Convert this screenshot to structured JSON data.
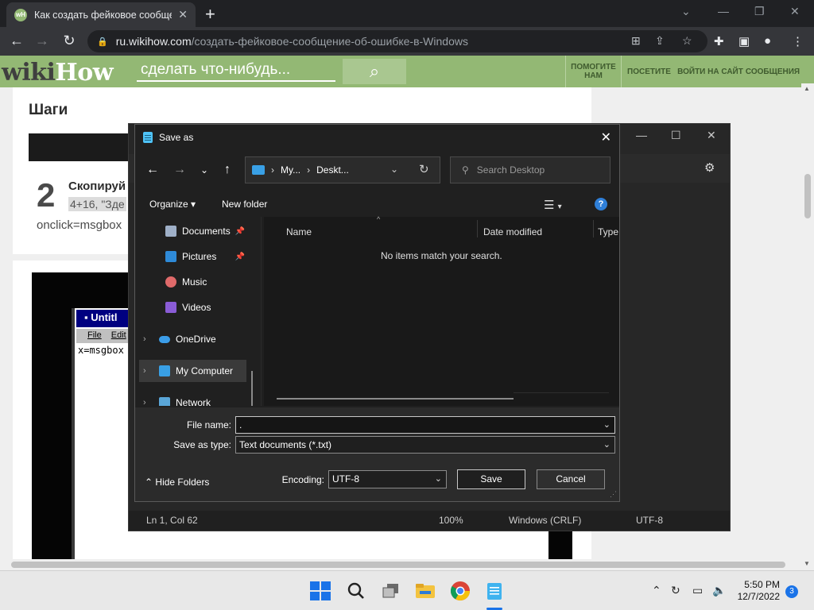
{
  "browser": {
    "tab_title": "Как создать фейковое сообщен",
    "favicon_text": "wH",
    "url_host": "ru.wikihow.com",
    "url_path": "/создать-фейковое-сообщение-об-ошибке-в-Windows"
  },
  "wikihow": {
    "logo_wiki": "wiki",
    "logo_how": "How",
    "search_placeholder": "сделать что-нибудь...",
    "nav": [
      "ПОМОГИТЕ НАМ",
      "ПОСЕТИТЕ",
      "ВОЙТИ НА САЙТ",
      "СООБЩЕНИЯ"
    ],
    "section_heading": "Шаги",
    "step_number": "2",
    "step_bold": "Скопируй",
    "step_code_line1": "4+16, \"Зде",
    "step_code_line2": "onclick=msgbox",
    "notepad_title": "Untitl",
    "notepad_menu": [
      "File",
      "Edit"
    ],
    "notepad_text": "x=msgbox"
  },
  "notepad": {
    "status": {
      "position": "Ln 1, Col 62",
      "zoom": "100%",
      "line_ending": "Windows (CRLF)",
      "encoding": "UTF-8"
    }
  },
  "dialog": {
    "title": "Save as",
    "breadcrumb": [
      "My...",
      "Deskt..."
    ],
    "search_placeholder": "Search Desktop",
    "organize": "Organize",
    "new_folder": "New folder",
    "nav_items": [
      {
        "label": "Documents",
        "pinned": true
      },
      {
        "label": "Pictures",
        "pinned": true
      },
      {
        "label": "Music"
      },
      {
        "label": "Videos"
      },
      {
        "label": "OneDrive"
      },
      {
        "label": "My Computer"
      },
      {
        "label": "Network"
      }
    ],
    "columns": [
      "Name",
      "Date modified",
      "Type"
    ],
    "empty_message": "No items match your search.",
    "file_name_label": "File name:",
    "file_name_value": ".",
    "save_type_label": "Save as type:",
    "save_type_value": "Text documents (*.txt)",
    "hide_folders": "Hide Folders",
    "encoding_label": "Encoding:",
    "encoding_value": "UTF-8",
    "save_button": "Save",
    "cancel_button": "Cancel"
  },
  "taskbar": {
    "time": "5:50 PM",
    "date": "12/7/2022",
    "notification_count": "3"
  }
}
